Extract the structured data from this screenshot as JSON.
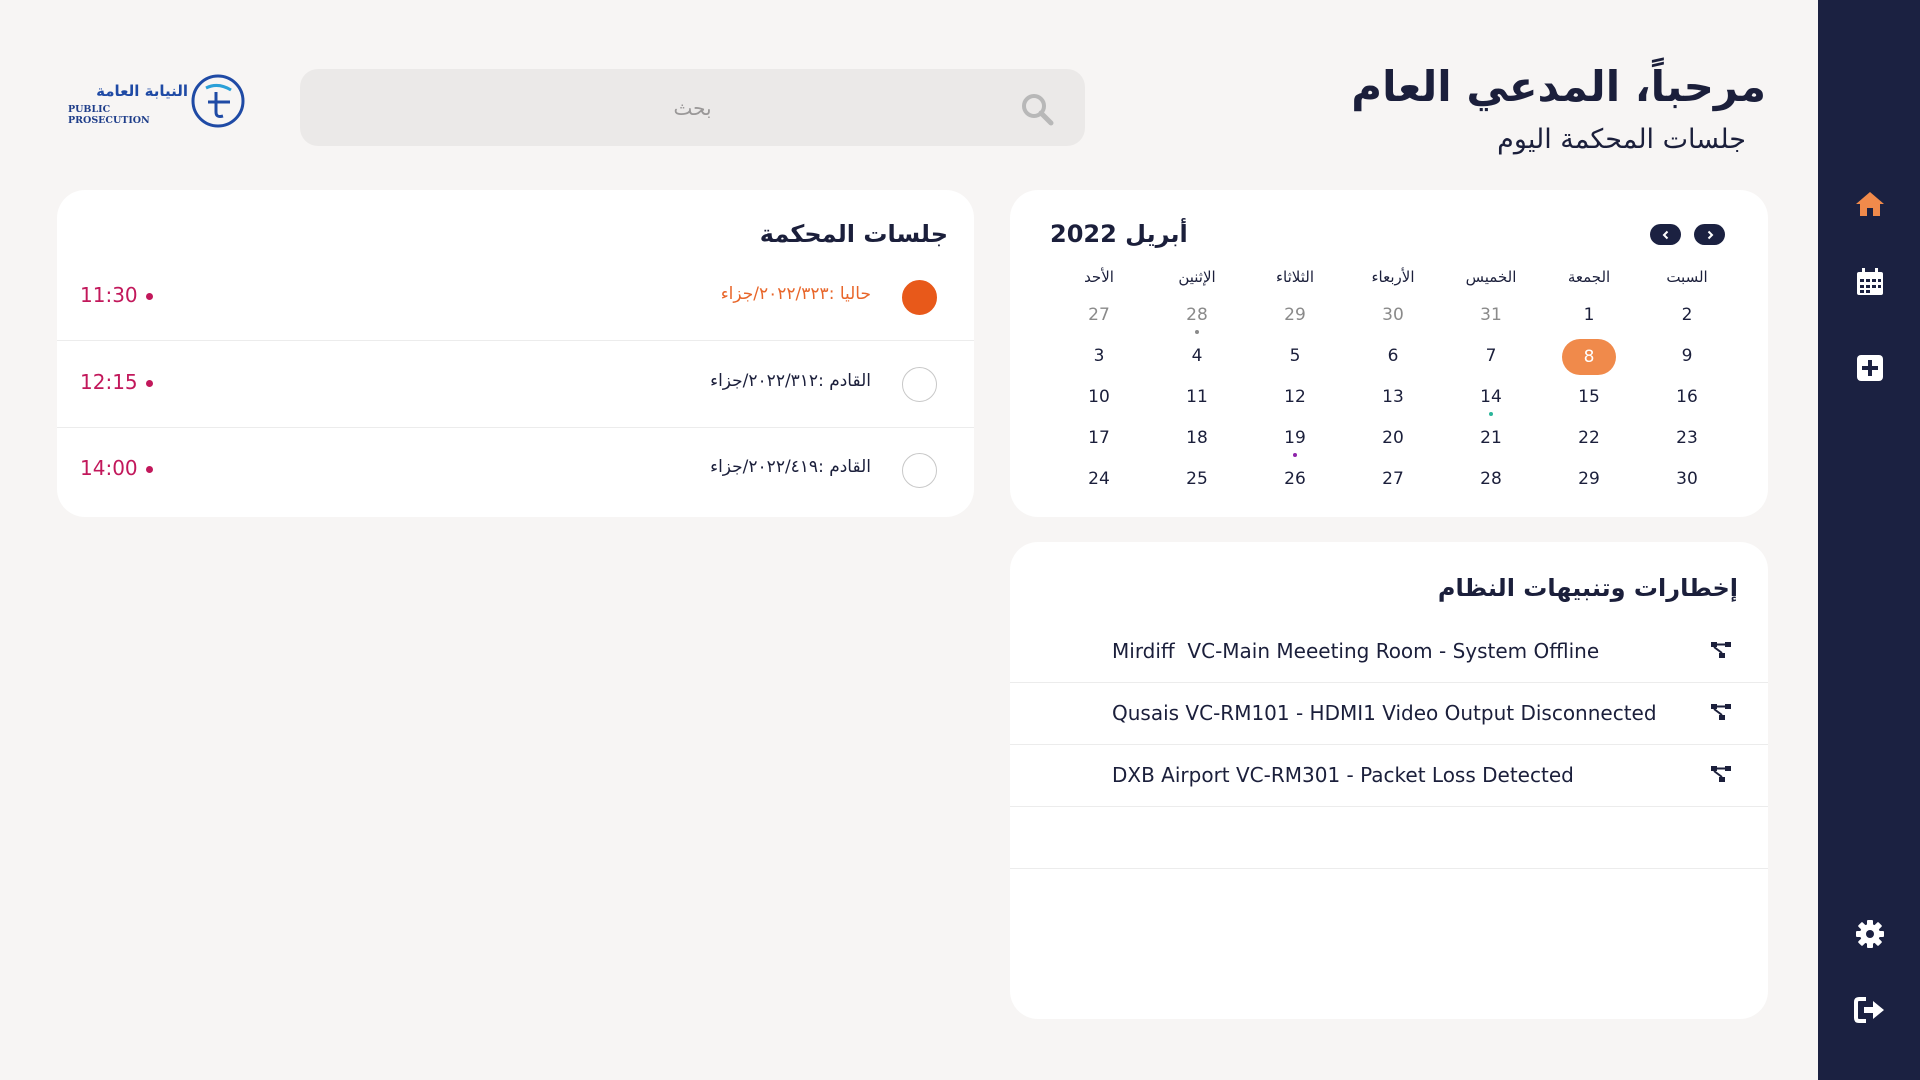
{
  "header": {
    "title": "مرحباً، المدعي العام",
    "subtitle": "جلسات المحكمة اليوم",
    "search_placeholder": "بحث",
    "logo_text_ar": "النيابة العامة",
    "logo_text_en": "PUBLIC PROSECUTION"
  },
  "sidebar": {
    "items": [
      {
        "icon": "home-icon",
        "color": "#f08a4b"
      },
      {
        "icon": "calendar-icon",
        "color": "#ffffff"
      },
      {
        "icon": "add-icon",
        "color": "#ffffff"
      },
      {
        "icon": "settings-icon",
        "color": "#ffffff"
      },
      {
        "icon": "logout-icon",
        "color": "#ffffff"
      }
    ]
  },
  "sessions": {
    "title": "جلسات المحكمة",
    "items": [
      {
        "text": "حاليا :٢٠٢٢/٣٢٣/جزاء",
        "time": "11:30",
        "current": true
      },
      {
        "text": "القادم :٢٠٢٢/٣١٢/جزاء",
        "time": "12:15",
        "current": false
      },
      {
        "text": "القادم :٢٠٢٢/٤١٩/جزاء",
        "time": "14:00",
        "current": false
      }
    ]
  },
  "calendar": {
    "month_label": "أبريل 2022",
    "weekdays": [
      "السبت",
      "الجمعة",
      "الخميس",
      "الأربعاء",
      "الثلاثاء",
      "الإثنين",
      "الأحد"
    ],
    "weeks": [
      [
        {
          "d": "2"
        },
        {
          "d": "1"
        },
        {
          "d": "31",
          "muted": true
        },
        {
          "d": "30",
          "muted": true
        },
        {
          "d": "29",
          "muted": true
        },
        {
          "d": "28",
          "muted": true,
          "dot": "#8a8a8a"
        },
        {
          "d": "27",
          "muted": true
        }
      ],
      [
        {
          "d": "9"
        },
        {
          "d": "8",
          "today": true
        },
        {
          "d": "7"
        },
        {
          "d": "6"
        },
        {
          "d": "5"
        },
        {
          "d": "4"
        },
        {
          "d": "3"
        }
      ],
      [
        {
          "d": "16"
        },
        {
          "d": "15"
        },
        {
          "d": "14",
          "dot": "#2bb59a"
        },
        {
          "d": "13"
        },
        {
          "d": "12"
        },
        {
          "d": "11"
        },
        {
          "d": "10"
        }
      ],
      [
        {
          "d": "23"
        },
        {
          "d": "22"
        },
        {
          "d": "21"
        },
        {
          "d": "20"
        },
        {
          "d": "19",
          "dot": "#8e24aa"
        },
        {
          "d": "18"
        },
        {
          "d": "17"
        }
      ],
      [
        {
          "d": "30"
        },
        {
          "d": "29"
        },
        {
          "d": "28"
        },
        {
          "d": "27"
        },
        {
          "d": "26"
        },
        {
          "d": "25"
        },
        {
          "d": "24"
        }
      ]
    ],
    "accent": "#f08a4b"
  },
  "alerts": {
    "title": "إخطارات وتنبيهات النظام",
    "items": [
      {
        "text": "Mirdiff  VC-Main Meeeting Room - System Offline"
      },
      {
        "text": "Qusais VC-RM101 - HDMI1 Video Output Disconnected"
      },
      {
        "text": "DXB Airport VC-RM301 - Packet Loss Detected"
      },
      {
        "text": ""
      }
    ]
  }
}
